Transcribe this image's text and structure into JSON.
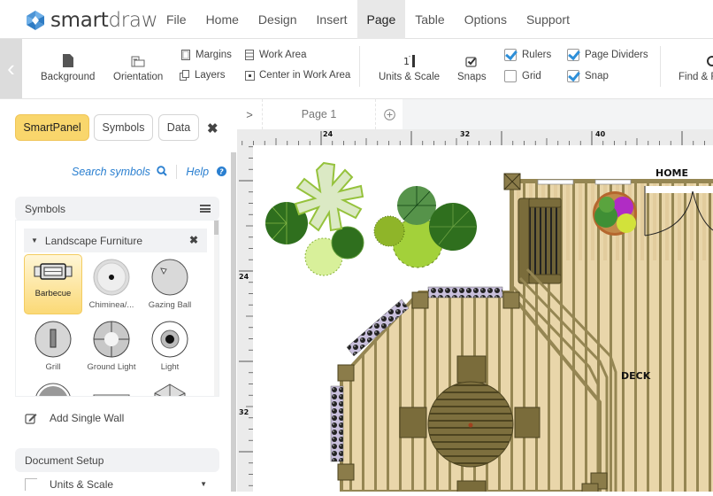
{
  "app": {
    "logo_bold": "smart",
    "logo_light": "draw"
  },
  "menu": {
    "items": [
      {
        "label": "File"
      },
      {
        "label": "Home"
      },
      {
        "label": "Design"
      },
      {
        "label": "Insert"
      },
      {
        "label": "Page",
        "active": true
      },
      {
        "label": "Table"
      },
      {
        "label": "Options"
      },
      {
        "label": "Support"
      }
    ]
  },
  "ribbon": {
    "collapse_glyph": "‹",
    "background_label": "Background",
    "orientation_label": "Orientation",
    "margins_label": "Margins",
    "layers_label": "Layers",
    "work_area_label": "Work Area",
    "center_label": "Center in Work Area",
    "units_label": "Units & Scale",
    "snaps_label": "Snaps",
    "rulers": {
      "label": "Rulers",
      "checked": true
    },
    "grid": {
      "label": "Grid",
      "checked": false
    },
    "page_dividers": {
      "label": "Page Dividers",
      "checked": true
    },
    "snap": {
      "label": "Snap",
      "checked": true
    },
    "find_label": "Find & R"
  },
  "left_panel": {
    "tabs": {
      "smartpanel": "SmartPanel",
      "symbols": "Symbols",
      "data": "Data"
    },
    "close_glyph": "✖",
    "search_link": "Search symbols",
    "help_link": "Help",
    "symbols_section": "Symbols",
    "library": {
      "title": "Landscape Furniture",
      "items": [
        {
          "label": "Barbecue",
          "selected": true
        },
        {
          "label": "Chiminea/..."
        },
        {
          "label": "Gazing Ball"
        },
        {
          "label": "Grill"
        },
        {
          "label": "Ground Light"
        },
        {
          "label": "Light"
        }
      ]
    },
    "add_wall": "Add Single Wall",
    "document_setup": "Document Setup",
    "units_scale": "Units & Scale"
  },
  "canvas": {
    "expand_glyph": ">",
    "page_tab": "Page 1",
    "ruler_top": [
      "24",
      "32",
      "40"
    ],
    "ruler_left": [
      "24",
      "32"
    ],
    "labels": {
      "home": "HOME",
      "deck": "DECK"
    }
  },
  "colors": {
    "accent_yellow": "#f9d66c",
    "link_blue": "#2a7fd0",
    "checkbox_blue": "#2e8fd8",
    "deck_wood": "#e7d3a6",
    "deck_trim": "#8a7c4e"
  }
}
